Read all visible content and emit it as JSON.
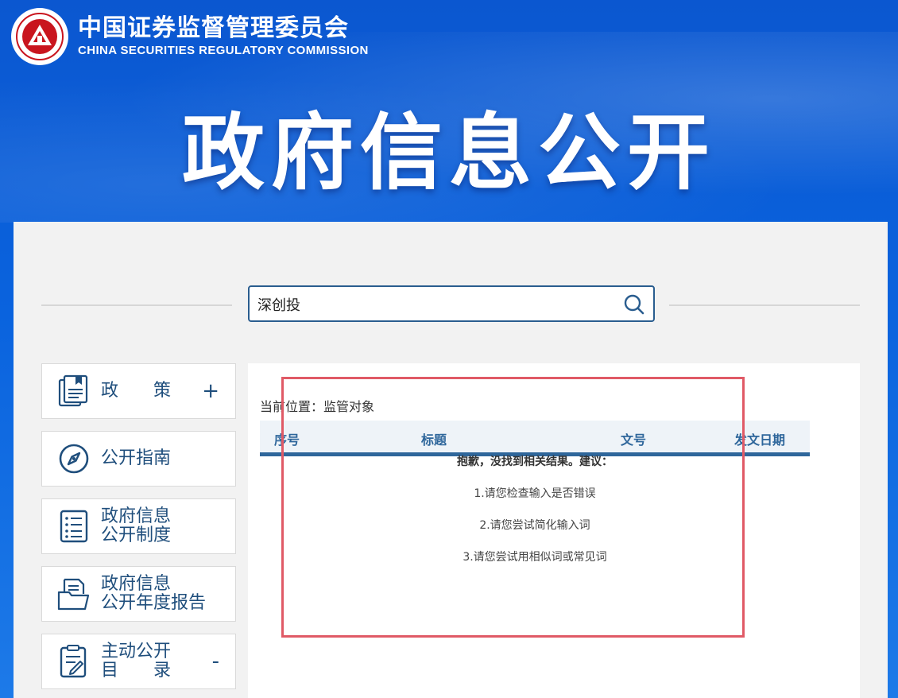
{
  "header": {
    "org_name_cn": "中国证券监督管理委员会",
    "org_name_en": "CHINA SECURITIES REGULATORY COMMISSION",
    "banner_title": "政府信息公开"
  },
  "search": {
    "value": "深创投"
  },
  "sidebar": {
    "items": [
      {
        "label": "政　　策",
        "toggle": "+"
      },
      {
        "label": "公开指南"
      },
      {
        "label_line1": "政府信息",
        "label_line2": "公开制度"
      },
      {
        "label_line1": "政府信息",
        "label_line2": "公开年度报告"
      },
      {
        "label_line1": "主动公开",
        "label_line2": "目　　录",
        "toggle": "-"
      }
    ]
  },
  "results": {
    "breadcrumb": "当前位置：监管对象",
    "columns": [
      "序号",
      "标题",
      "文号",
      "发文日期"
    ],
    "empty_title": "抱歉，没找到相关结果。建议：",
    "suggestions": [
      "1.请您检查输入是否错误",
      "2.请您尝试简化输入词",
      "3.请您尝试用相似词或常见词"
    ]
  },
  "colors": {
    "banner_blue": "#0b57d0",
    "nav_text": "#1f4e7c",
    "table_accent": "#2e669b",
    "highlight_border": "#e05a66"
  }
}
